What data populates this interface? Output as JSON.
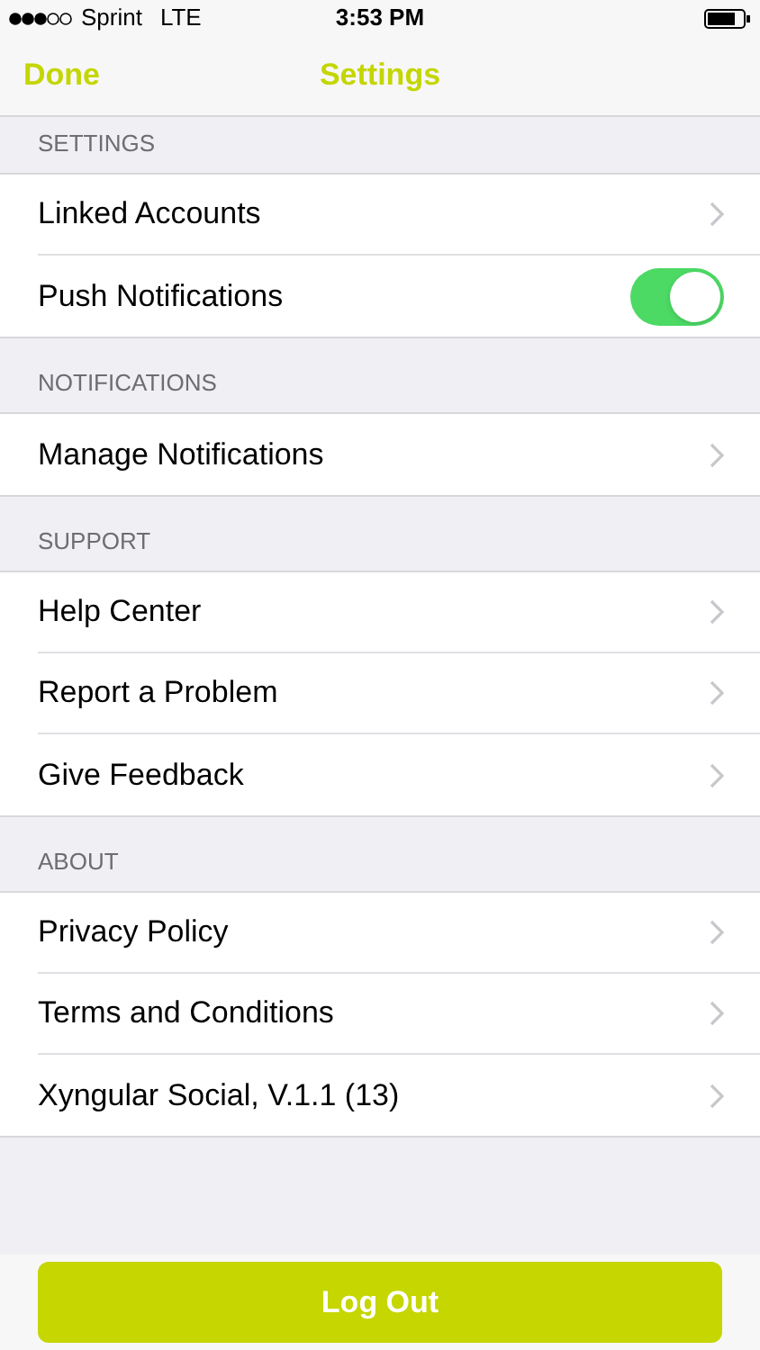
{
  "status_bar": {
    "carrier": "Sprint",
    "network": "LTE",
    "time": "3:53 PM"
  },
  "nav": {
    "left": "Done",
    "title": "Settings"
  },
  "sections": [
    {
      "header": "SETTINGS",
      "rows": [
        {
          "kind": "link",
          "label": "Linked Accounts"
        },
        {
          "kind": "toggle",
          "label": "Push Notifications",
          "on": true
        }
      ]
    },
    {
      "header": "NOTIFICATIONS",
      "rows": [
        {
          "kind": "link",
          "label": "Manage Notifications"
        }
      ]
    },
    {
      "header": "SUPPORT",
      "rows": [
        {
          "kind": "link",
          "label": "Help Center"
        },
        {
          "kind": "link",
          "label": "Report a Problem"
        },
        {
          "kind": "link",
          "label": "Give Feedback"
        }
      ]
    },
    {
      "header": "ABOUT",
      "rows": [
        {
          "kind": "link",
          "label": "Privacy Policy"
        },
        {
          "kind": "link",
          "label": "Terms and Conditions"
        },
        {
          "kind": "link",
          "label": "Xyngular Social, V.1.1 (13)"
        }
      ]
    }
  ],
  "logout_button": "Log Out"
}
